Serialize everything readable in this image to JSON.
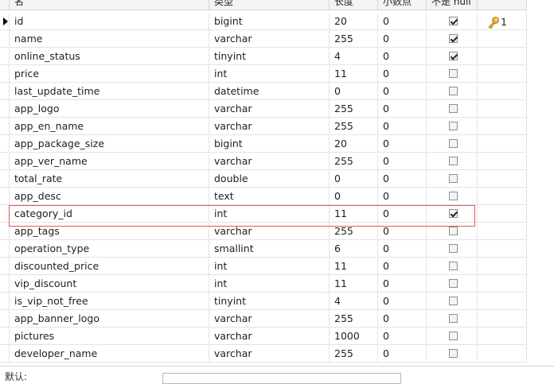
{
  "columns": {
    "name": "名",
    "type": "类型",
    "length": "长度",
    "decimals": "小数点",
    "not_null": "不是 null"
  },
  "fields": [
    {
      "name": "id",
      "type": "bigint",
      "length": "20",
      "decimals": "0",
      "not_null": true,
      "key": "1"
    },
    {
      "name": "name",
      "type": "varchar",
      "length": "255",
      "decimals": "0",
      "not_null": true,
      "key": ""
    },
    {
      "name": "online_status",
      "type": "tinyint",
      "length": "4",
      "decimals": "0",
      "not_null": true,
      "key": ""
    },
    {
      "name": "price",
      "type": "int",
      "length": "11",
      "decimals": "0",
      "not_null": false,
      "key": ""
    },
    {
      "name": "last_update_time",
      "type": "datetime",
      "length": "0",
      "decimals": "0",
      "not_null": false,
      "key": ""
    },
    {
      "name": "app_logo",
      "type": "varchar",
      "length": "255",
      "decimals": "0",
      "not_null": false,
      "key": ""
    },
    {
      "name": "app_en_name",
      "type": "varchar",
      "length": "255",
      "decimals": "0",
      "not_null": false,
      "key": ""
    },
    {
      "name": "app_package_size",
      "type": "bigint",
      "length": "20",
      "decimals": "0",
      "not_null": false,
      "key": ""
    },
    {
      "name": "app_ver_name",
      "type": "varchar",
      "length": "255",
      "decimals": "0",
      "not_null": false,
      "key": ""
    },
    {
      "name": "total_rate",
      "type": "double",
      "length": "0",
      "decimals": "0",
      "not_null": false,
      "key": ""
    },
    {
      "name": "app_desc",
      "type": "text",
      "length": "0",
      "decimals": "0",
      "not_null": false,
      "key": ""
    },
    {
      "name": "category_id",
      "type": "int",
      "length": "11",
      "decimals": "0",
      "not_null": true,
      "key": ""
    },
    {
      "name": "app_tags",
      "type": "varchar",
      "length": "255",
      "decimals": "0",
      "not_null": false,
      "key": ""
    },
    {
      "name": "operation_type",
      "type": "smallint",
      "length": "6",
      "decimals": "0",
      "not_null": false,
      "key": ""
    },
    {
      "name": "discounted_price",
      "type": "int",
      "length": "11",
      "decimals": "0",
      "not_null": false,
      "key": ""
    },
    {
      "name": "vip_discount",
      "type": "int",
      "length": "11",
      "decimals": "0",
      "not_null": false,
      "key": ""
    },
    {
      "name": "is_vip_not_free",
      "type": "tinyint",
      "length": "4",
      "decimals": "0",
      "not_null": false,
      "key": ""
    },
    {
      "name": "app_banner_logo",
      "type": "varchar",
      "length": "255",
      "decimals": "0",
      "not_null": false,
      "key": ""
    },
    {
      "name": "pictures",
      "type": "varchar",
      "length": "1000",
      "decimals": "0",
      "not_null": false,
      "key": ""
    },
    {
      "name": "developer_name",
      "type": "varchar",
      "length": "255",
      "decimals": "0",
      "not_null": false,
      "key": ""
    }
  ],
  "selected_row": 0,
  "highlighted_row": 11,
  "bottom": {
    "default_label": "默认:"
  },
  "colors": {
    "highlight_border": "#e05a5a",
    "key_icon": "#e8b12c"
  },
  "icons": {
    "row_indicator": "triangle-right-icon",
    "primary_key": "key-icon"
  }
}
